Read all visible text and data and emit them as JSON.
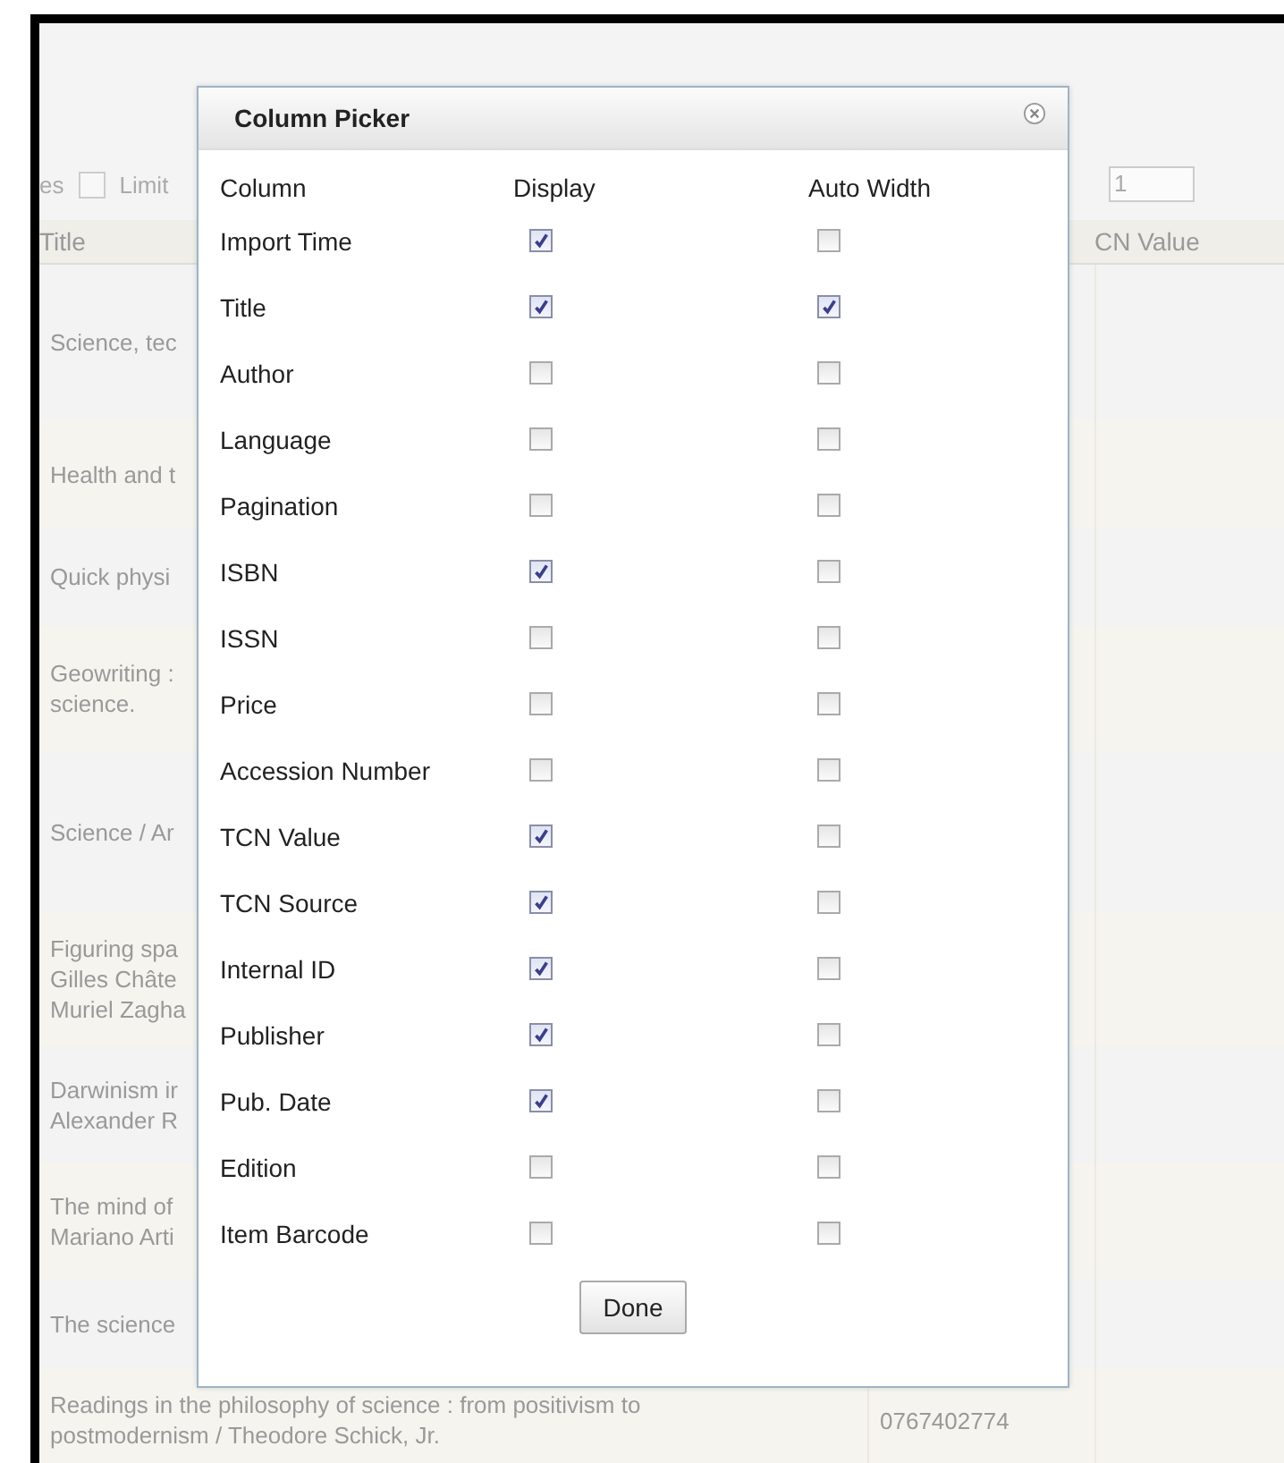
{
  "toolbar": {
    "label_1": "es",
    "checkbox": {
      "checked": false
    },
    "label_2": "Limit",
    "field_value": "1"
  },
  "table": {
    "columns": [
      "Title",
      "CN Value"
    ],
    "rows": [
      {
        "title": [
          "Science, tec"
        ]
      },
      {
        "title": [
          "Health and t"
        ]
      },
      {
        "title": [
          "Quick physi"
        ]
      },
      {
        "title": [
          "Geowriting :",
          "science."
        ]
      },
      {
        "title": [
          "Science / Ar"
        ]
      },
      {
        "title": [
          "Figuring spa",
          "Gilles Châte",
          "Muriel Zagha"
        ]
      },
      {
        "title": [
          "Darwinism ir",
          "Alexander R"
        ]
      },
      {
        "title": [
          "The mind of",
          "Mariano Arti"
        ]
      },
      {
        "title": [
          "The science"
        ]
      },
      {
        "title": [
          "Readings in the philosophy of science : from positivism to",
          "postmodernism / Theodore Schick, Jr."
        ],
        "column_2": "0767402774"
      }
    ]
  },
  "dialog": {
    "title": "Column Picker",
    "headers": [
      "Column",
      "Display",
      "Auto Width"
    ],
    "rows": [
      {
        "label": "Import Time",
        "display": true,
        "auto_width": false
      },
      {
        "label": "Title",
        "display": true,
        "auto_width": true
      },
      {
        "label": "Author",
        "display": false,
        "auto_width": false
      },
      {
        "label": "Language",
        "display": false,
        "auto_width": false
      },
      {
        "label": "Pagination",
        "display": false,
        "auto_width": false
      },
      {
        "label": "ISBN",
        "display": true,
        "auto_width": false
      },
      {
        "label": "ISSN",
        "display": false,
        "auto_width": false
      },
      {
        "label": "Price",
        "display": false,
        "auto_width": false
      },
      {
        "label": "Accession Number",
        "display": false,
        "auto_width": false
      },
      {
        "label": "TCN Value",
        "display": true,
        "auto_width": false
      },
      {
        "label": "TCN Source",
        "display": true,
        "auto_width": false
      },
      {
        "label": "Internal ID",
        "display": true,
        "auto_width": false
      },
      {
        "label": "Publisher",
        "display": true,
        "auto_width": false
      },
      {
        "label": "Pub. Date",
        "display": true,
        "auto_width": false
      },
      {
        "label": "Edition",
        "display": false,
        "auto_width": false
      },
      {
        "label": "Item Barcode",
        "display": false,
        "auto_width": false
      }
    ],
    "button": "Done"
  }
}
